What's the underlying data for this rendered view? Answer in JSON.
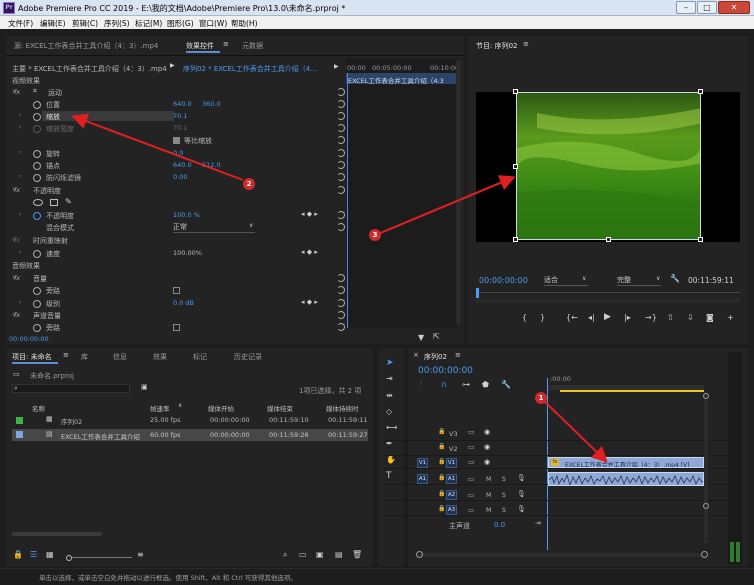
{
  "window": {
    "title": "Adobe Premiere Pro CC 2019 - E:\\我的文档\\Adobe\\Premiere Pro\\13.0\\未命名.prproj *",
    "app_icon": "Pr"
  },
  "menu": [
    "文件(F)",
    "编辑(E)",
    "剪辑(C)",
    "序列(S)",
    "标记(M)",
    "图形(G)",
    "窗口(W)",
    "帮助(H)"
  ],
  "effect_panel": {
    "tabs": [
      "源: EXCEL工作表合并工具介绍（4：3）.mp4",
      "效果控件",
      "元数据"
    ],
    "master_label": "主要 * EXCEL工作表合并工具介绍（4：3）.mp4",
    "sequence_label": "序列02 * EXCEL工作表合并工具介绍（4...",
    "timecodes": [
      "00:00",
      "00:05:00:00",
      "00:10:00"
    ],
    "clip_bar": "EXCEL工作表合并工具介绍（4:3",
    "video_effects": "视频效果",
    "motion": "运动",
    "position": {
      "label": "位置",
      "x": "640.0",
      "y": "360.0"
    },
    "scale": {
      "label": "缩放",
      "value": "70.1"
    },
    "scale_width": {
      "label": "缩放宽度",
      "value": "70.1"
    },
    "uniform_scale": "等比缩放",
    "rotation": {
      "label": "旋转",
      "value": "0.0"
    },
    "anchor": {
      "label": "锚点",
      "x": "640.0",
      "y": "512.0"
    },
    "antiflicker": {
      "label": "防闪烁滤镜",
      "value": "0.00"
    },
    "opacity_group": "不透明度",
    "opacity": {
      "label": "不透明度",
      "value": "100.0 %"
    },
    "blend": {
      "label": "混合模式",
      "value": "正常"
    },
    "time_remap": "时间重映射",
    "speed": {
      "label": "速度",
      "value": "100.00%"
    },
    "audio_effects": "音频效果",
    "volume": "音量",
    "bypass": "旁路",
    "level": {
      "label": "级别",
      "value": "0.0 dB"
    },
    "channel_volume": "声道音量",
    "bypass2": "旁路",
    "bottom_timecode": "00:00:00:00"
  },
  "program_monitor": {
    "title": "节目: 序列02",
    "timecode": "00:00:00:00",
    "fit": "适合",
    "quality": "完整",
    "duration": "00:11:59:11"
  },
  "project": {
    "tabs": [
      "项目: 未命名",
      "库",
      "信息",
      "效果",
      "标记",
      "历史记录"
    ],
    "file": "未命名.prproj",
    "selection": "1项已选择，共 2 项",
    "columns": [
      "名称",
      "帧速率",
      "媒体开始",
      "媒体结束",
      "媒体持续时"
    ],
    "rows": [
      {
        "name": "序列02",
        "fps": "25.00 fps",
        "start": "00:00:00:00",
        "end": "00:11:59:10",
        "dur": "00:11:59:11",
        "color": "#3fb24a"
      },
      {
        "name": "EXCEL工作表合并工具介绍",
        "fps": "60.00 fps",
        "start": "00:00:00:00",
        "end": "00:11:59:26",
        "dur": "00:11:59:27",
        "color": "#7aa7e0"
      }
    ]
  },
  "timeline": {
    "title": "序列02",
    "timecode": "00:00:00:00",
    "ruler_start": ":00:00",
    "tracks": [
      "V3",
      "V2",
      "V1",
      "A1",
      "A2",
      "A3"
    ],
    "master": "主声道",
    "master_value": "0.0",
    "clip_video": "EXCEL工作表合并工具介绍（4：3）.mp4 [V]",
    "m": "M",
    "s": "S"
  },
  "status": "单击以选择，或单击空白处并拖动以进行框选。使用 Shift、Alt 和 Ctrl 可获得其他选项。",
  "annotations": [
    "1",
    "2",
    "3"
  ]
}
